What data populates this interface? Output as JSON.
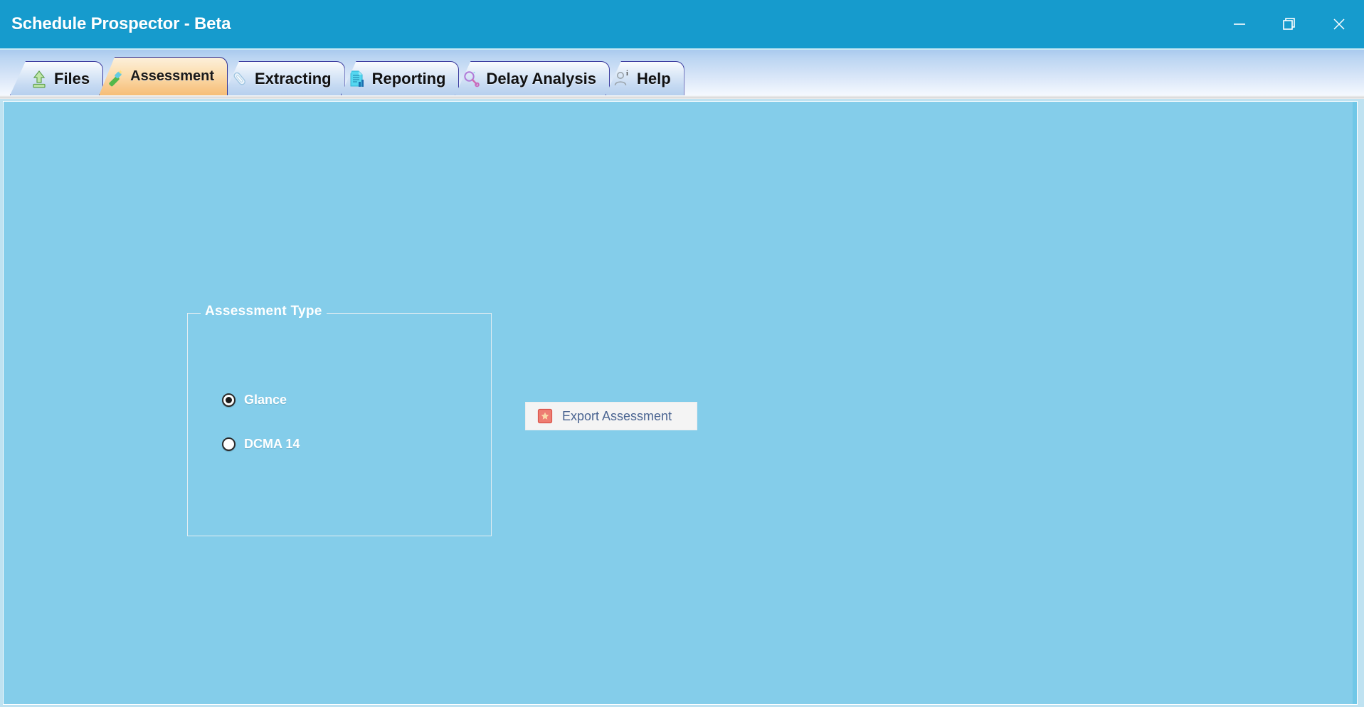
{
  "window": {
    "title": "Schedule Prospector - Beta",
    "controls": [
      {
        "name": "minimize",
        "icon": "minimize-icon",
        "label": "–"
      },
      {
        "name": "restore",
        "icon": "restore-icon",
        "label": "❐"
      },
      {
        "name": "close",
        "icon": "close-icon",
        "label": "×"
      }
    ],
    "titlebar_color": "#169BCD",
    "content_color": "#84CDEA"
  },
  "tabs": [
    {
      "label": "Files",
      "icon": "upload-arrow-icon",
      "active": false
    },
    {
      "label": "Assessment",
      "icon": "magic-wand-icon",
      "active": true
    },
    {
      "label": "Extracting",
      "icon": "paperclip-pen-icon",
      "active": false
    },
    {
      "label": "Reporting",
      "icon": "document-chart-icon",
      "active": false
    },
    {
      "label": "Delay Analysis",
      "icon": "magnifier-icon",
      "active": false
    },
    {
      "label": "Help",
      "icon": "user-info-icon",
      "active": false
    }
  ],
  "assessment_panel": {
    "group_title": "Assessment Type",
    "options": [
      {
        "label": "Glance",
        "selected": true
      },
      {
        "label": "DCMA 14",
        "selected": false
      }
    ]
  },
  "export": {
    "label": "Export Assessment",
    "icon": "export-excel-icon",
    "icon_color": "#EE7D72",
    "text_color": "#4A6491"
  }
}
